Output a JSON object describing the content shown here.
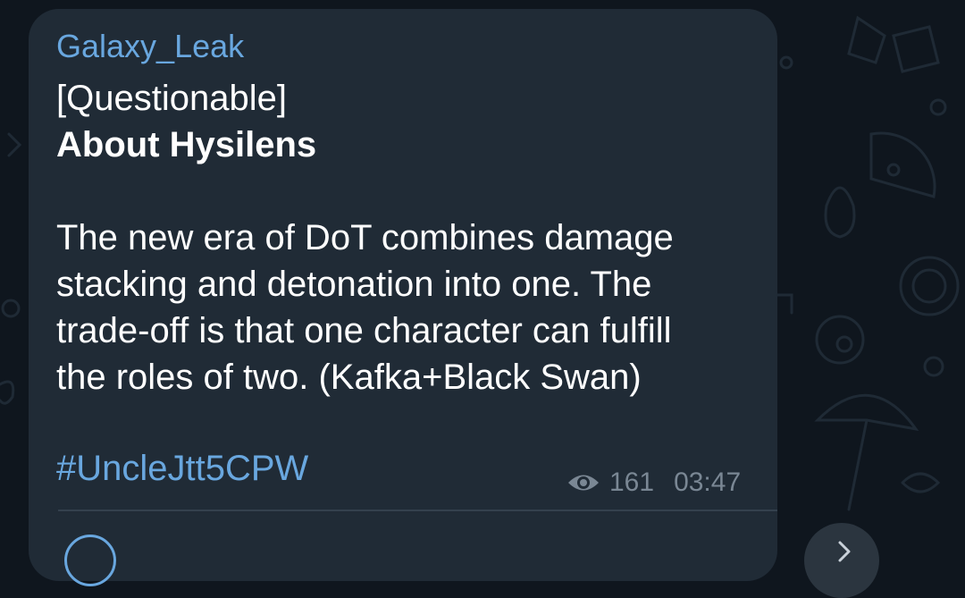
{
  "message": {
    "sender": "Galaxy_Leak",
    "tag_line": "[Questionable]",
    "title": "About Hysilens",
    "body_lines": [
      "The new era of DoT combines damage",
      "stacking and detonation into one. The",
      "trade-off is that one character can fulfill",
      "the roles of two. (Kafka+Black Swan)"
    ],
    "hashtag": "#UncleJtt5CPW",
    "views": "161",
    "time": "03:47"
  },
  "icons": {
    "views": "eye-icon",
    "comment": "comment-icon",
    "share": "share-arrow-icon"
  },
  "colors": {
    "background": "#0f161e",
    "bubble": "#202b36",
    "accent": "#69a7df",
    "text": "#ffffff",
    "meta": "#7a8794"
  }
}
